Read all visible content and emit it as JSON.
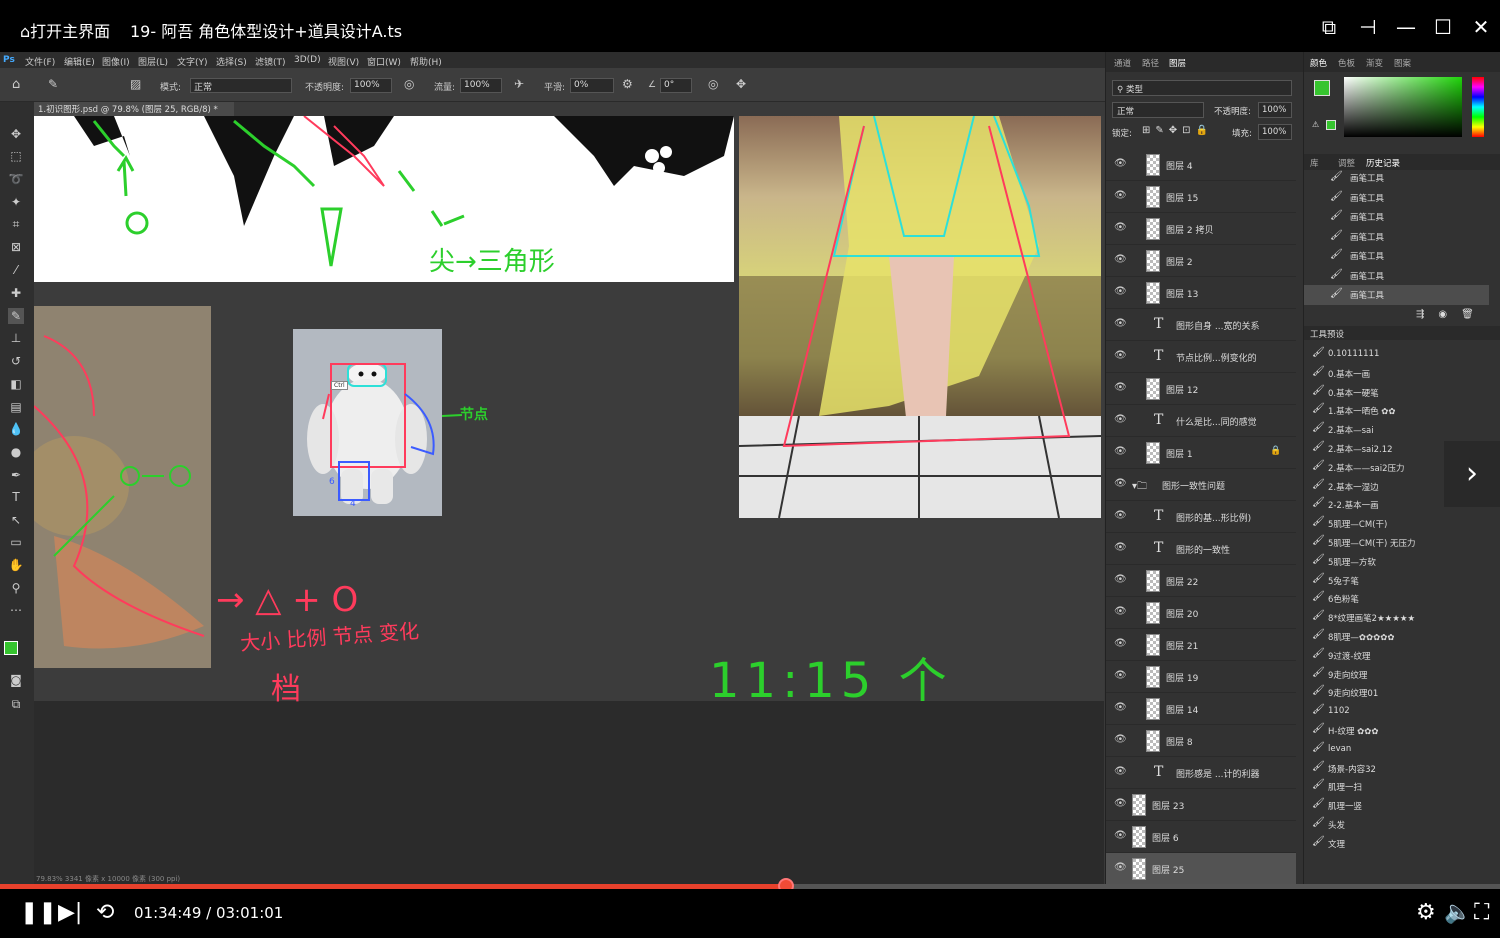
{
  "player": {
    "home_label": "打开主界面",
    "title": "19- 阿吾 角色体型设计+道具设计A.ts",
    "time_current": "01:34:49",
    "time_separator": " / ",
    "time_total": "03:01:01",
    "progress_fraction": 0.524
  },
  "menu": [
    "文件(F)",
    "编辑(E)",
    "图像(I)",
    "图层(L)",
    "文字(Y)",
    "选择(S)",
    "滤镜(T)",
    "3D(D)",
    "视图(V)",
    "窗口(W)",
    "帮助(H)"
  ],
  "options": {
    "mode_label": "模式:",
    "mode_value": "正常",
    "opacity_label": "不透明度:",
    "opacity_value": "100%",
    "flow_label": "流量:",
    "flow_value": "100%",
    "smooth_label": "平滑:",
    "smooth_value": "0%",
    "angle_value": "0°"
  },
  "doc_tab": "1.初识图形.psd @ 79.8% (图层 25, RGB/8) *",
  "status_text": "79.83%  3341 像素 x 10000 像素 (300 ppi)",
  "canvas_text": {
    "handwriting_1": "尖→三角形",
    "handwriting_2": "→ △ + O",
    "handwriting_3": "大小 比例 节点 变化",
    "handwriting_4": "档",
    "handwriting_5": "11:15 个",
    "handwriting_6": "节点",
    "ctrl_tag": "Ctrl",
    "num_1": "6",
    "num_2": "4"
  },
  "layers_tabs": [
    "通道",
    "路径",
    "图层"
  ],
  "layers_controls": {
    "kind": "类型",
    "blend": "正常",
    "opacity_label": "不透明度:",
    "opacity_value": "100%",
    "lock_label": "锁定:",
    "fill_label": "填充:",
    "fill_value": "100%"
  },
  "layers": [
    {
      "name": "图层 4",
      "type": "pixel"
    },
    {
      "name": "图层 15",
      "type": "pixel"
    },
    {
      "name": "图层 2 拷贝",
      "type": "pixel"
    },
    {
      "name": "图层 2",
      "type": "pixel"
    },
    {
      "name": "图层 13",
      "type": "pixel"
    },
    {
      "name": "图形自身 ...宽的关系",
      "type": "text"
    },
    {
      "name": "节点比例...例变化的",
      "type": "text"
    },
    {
      "name": "图层 12",
      "type": "pixel"
    },
    {
      "name": "什么是比...同的感觉",
      "type": "text"
    },
    {
      "name": "图层 1",
      "type": "pixel"
    },
    {
      "name": "图形一致性问题",
      "type": "group"
    },
    {
      "name": "图形的基...形比例)",
      "type": "text"
    },
    {
      "name": "图形的一致性",
      "type": "text"
    },
    {
      "name": "图层 22",
      "type": "pixel"
    },
    {
      "name": "图层 20",
      "type": "pixel"
    },
    {
      "name": "图层 21",
      "type": "pixel"
    },
    {
      "name": "图层 19",
      "type": "pixel"
    },
    {
      "name": "图层 14",
      "type": "pixel"
    },
    {
      "name": "图层 8",
      "type": "pixel"
    },
    {
      "name": "图形感是 ...计的利器",
      "type": "text"
    },
    {
      "name": "图层 23",
      "type": "pixel"
    },
    {
      "name": "图层 6",
      "type": "pixel"
    },
    {
      "name": "图层 25",
      "type": "pixel"
    }
  ],
  "color_tabs": [
    "颜色",
    "色板",
    "渐变",
    "图案"
  ],
  "history_tabs": [
    "库",
    "调整",
    "历史记录"
  ],
  "history": [
    "画笔工具",
    "画笔工具",
    "画笔工具",
    "画笔工具",
    "画笔工具",
    "画笔工具",
    "画笔工具"
  ],
  "presets_title": "工具预设",
  "presets": [
    "0.10111111",
    "0.基本一画",
    "0.基本一硬笔",
    "1.基本一晒色 ✿✿",
    "2.基本—sai",
    "2.基本—sai2.12",
    "2.基本——sai2压力",
    "2.基本一湿边",
    "2-2.基本一画",
    "5肌理—CM(干)",
    "5肌理—CM(干) 无压力",
    "5肌理—方软",
    "5兔子笔",
    "6色粉笔",
    "8*纹理画笔2★★★★★",
    "8肌理—✿✿✿✿✿",
    "9过渡-纹理",
    "9走向纹理",
    "9走向纹理01",
    "1102",
    "H-纹理 ✿✿✿",
    "levan",
    "场景-内容32",
    "肌理一扫",
    "肌理一竖",
    "头发",
    "文理"
  ],
  "colors": {
    "accent": "#e8412c",
    "foreground": "#36c42f",
    "stroke_green": "#2ccf2c",
    "stroke_red": "#ff3b5c",
    "stroke_cyan": "#2de0d8"
  }
}
